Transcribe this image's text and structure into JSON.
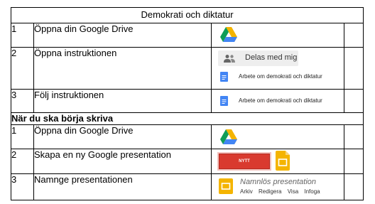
{
  "title": "Demokrati och diktatur",
  "section1": {
    "rows": [
      {
        "num": "1",
        "text": "Öppna din Google Drive"
      },
      {
        "num": "2",
        "text": "Öppna instruktionen"
      },
      {
        "num": "3",
        "text": "Följ instruktionen"
      }
    ],
    "shared_chip": "Delas med mig",
    "doc_name": "Arbete om demokrati och diktatur"
  },
  "section2": {
    "heading": "När du ska börja skriva",
    "rows": [
      {
        "num": "1",
        "text": "Öppna din Google Drive"
      },
      {
        "num": "2",
        "text": "Skapa en ny Google presentation"
      },
      {
        "num": "3",
        "text": "Namnge presentationen"
      }
    ],
    "new_button": "NYTT",
    "presentation_title": "Namnlös presentation",
    "menu": [
      "Arkiv",
      "Redigera",
      "Visa",
      "Infoga"
    ]
  },
  "colors": {
    "drive_green": "#0f9d58",
    "drive_yellow": "#f4b400",
    "drive_blue": "#4285f4",
    "doc_blue": "#4285f4",
    "new_button_red": "#d93a2f",
    "slides_yellow": "#f4b400"
  },
  "icons": [
    "google-drive-icon",
    "people-icon",
    "google-docs-icon",
    "google-slides-icon"
  ]
}
